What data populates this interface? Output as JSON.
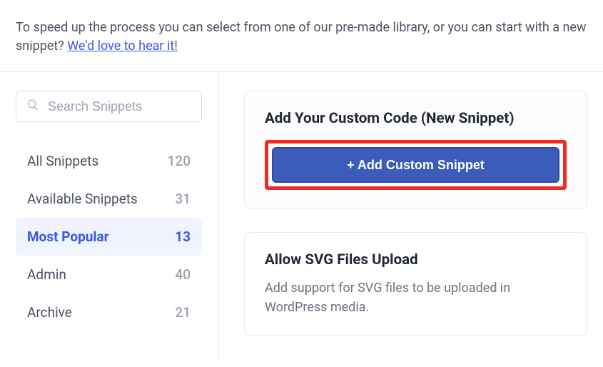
{
  "intro": {
    "text_before": "To speed up the process you can select from one of our pre-made library, or you can start with a new snippet? ",
    "link_text": "We'd love to hear it!"
  },
  "search": {
    "placeholder": "Search Snippets"
  },
  "nav": {
    "items": [
      {
        "label": "All Snippets",
        "count": "120"
      },
      {
        "label": "Available Snippets",
        "count": "31"
      },
      {
        "label": "Most Popular",
        "count": "13"
      },
      {
        "label": "Admin",
        "count": "40"
      },
      {
        "label": "Archive",
        "count": "21"
      }
    ]
  },
  "card_add": {
    "title": "Add Your Custom Code (New Snippet)",
    "button": "+ Add Custom Snippet"
  },
  "card_svg": {
    "title": "Allow SVG Files Upload",
    "desc": "Add support for SVG files to be uploaded in WordPress media."
  }
}
